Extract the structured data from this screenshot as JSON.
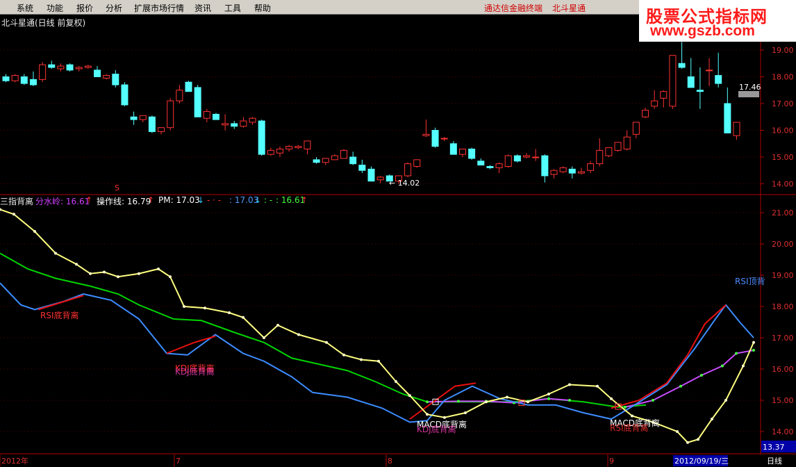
{
  "menu": {
    "items": [
      "系统",
      "功能",
      "报价",
      "分析",
      "扩展市场行情",
      "资讯",
      "工具",
      "帮助"
    ],
    "link1": "通达信金融终端",
    "link2": "北斗星通"
  },
  "watermark": {
    "line1": "股票公式指标网",
    "line2": "www.gszb.com"
  },
  "title": "北斗星通(日线 前复权)",
  "indicator": {
    "name": "三指背离",
    "l1": "分水岭: 16.61",
    "l2": "操作线: 16.79",
    "l3": "PM: 17.03",
    "l4": "- · - ",
    "l5": ": 17.03",
    "l6": ": - ",
    "l7": ": 16.61",
    "up": "↑",
    "down": "↓"
  },
  "price_axis": [
    "19.00",
    "18.00",
    "17.00",
    "16.00",
    "15.00",
    "14.00"
  ],
  "ind_axis": [
    "21.00",
    "20.00",
    "19.00",
    "18.00",
    "17.00",
    "16.00",
    "15.00",
    "14.00"
  ],
  "price_labels": {
    "high": "17.46",
    "low": "14.02"
  },
  "current_value": "13.37",
  "period": "日线",
  "dates": {
    "d0": "2012年",
    "d1": "7",
    "d2": "8",
    "d3": "9",
    "cursor": "2012/09/19/三"
  },
  "signals": {
    "s": "S",
    "rsi_bottom": "RSI底背离",
    "kdj_bottom": "KDJ底背离",
    "kdj_bottom_b": "KDJ底背离",
    "macd1": "MACD底背离",
    "kdj2": "KDJ底背离",
    "macd2": "MACD底背离",
    "rsi2": "RSI底背离",
    "rsi_top": "RSI顶背"
  },
  "colors": {
    "up": "#ff3232",
    "down": "#54ffff",
    "green": "#00d400",
    "yellow": "#ffff80",
    "blue": "#3c8cff",
    "red": "#e81010",
    "purple": "#c84cff"
  },
  "chart_data": {
    "type": "candlestick",
    "candles": [
      [
        18.0,
        18.1,
        17.8,
        17.85
      ],
      [
        17.85,
        18.1,
        17.8,
        18.05
      ],
      [
        18.0,
        18.1,
        17.7,
        17.75
      ],
      [
        17.9,
        18.2,
        17.65,
        17.7
      ],
      [
        17.9,
        18.55,
        17.8,
        18.45
      ],
      [
        18.45,
        18.6,
        18.3,
        18.35
      ],
      [
        18.3,
        18.5,
        18.2,
        18.4
      ],
      [
        18.45,
        18.5,
        18.2,
        18.25
      ],
      [
        18.3,
        18.4,
        18.2,
        18.35
      ],
      [
        18.35,
        18.45,
        18.3,
        18.4
      ],
      [
        18.25,
        18.4,
        18.0,
        18.0
      ],
      [
        17.95,
        18.1,
        17.9,
        18.05
      ],
      [
        18.1,
        18.25,
        17.6,
        17.7
      ],
      [
        17.7,
        17.8,
        16.9,
        16.95
      ],
      [
        16.5,
        16.7,
        16.2,
        16.4
      ],
      [
        16.4,
        16.55,
        16.3,
        16.55
      ],
      [
        16.5,
        16.55,
        15.9,
        15.95
      ],
      [
        15.95,
        16.1,
        15.85,
        16.1
      ],
      [
        16.1,
        17.2,
        16.0,
        17.1
      ],
      [
        17.1,
        17.7,
        17.0,
        17.5
      ],
      [
        17.8,
        17.85,
        17.45,
        17.45
      ],
      [
        17.6,
        17.7,
        16.5,
        16.5
      ],
      [
        16.45,
        16.8,
        16.3,
        16.7
      ],
      [
        16.6,
        16.65,
        16.4,
        16.4
      ],
      [
        16.2,
        16.6,
        16.0,
        16.25
      ],
      [
        16.25,
        16.35,
        16.05,
        16.15
      ],
      [
        16.15,
        16.5,
        16.1,
        16.35
      ],
      [
        16.3,
        16.5,
        16.2,
        16.45
      ],
      [
        16.35,
        16.4,
        15.05,
        15.1
      ],
      [
        15.1,
        15.35,
        15.05,
        15.25
      ],
      [
        15.15,
        15.4,
        15.0,
        15.3
      ],
      [
        15.3,
        15.45,
        15.2,
        15.4
      ],
      [
        15.35,
        15.45,
        15.3,
        15.4
      ],
      [
        15.3,
        15.6,
        15.1,
        15.6
      ],
      [
        14.9,
        15.0,
        14.75,
        14.8
      ],
      [
        14.8,
        14.95,
        14.7,
        14.95
      ],
      [
        14.9,
        15.1,
        14.9,
        15.05
      ],
      [
        14.95,
        15.3,
        14.95,
        15.25
      ],
      [
        15.0,
        15.2,
        14.7,
        14.75
      ],
      [
        14.7,
        14.9,
        14.4,
        14.5
      ],
      [
        14.55,
        14.65,
        14.1,
        14.1
      ],
      [
        14.15,
        14.3,
        14.02,
        14.25
      ],
      [
        14.3,
        14.35,
        14.1,
        14.1
      ],
      [
        14.1,
        14.3,
        14.0,
        14.3
      ],
      [
        14.3,
        14.8,
        14.25,
        14.75
      ],
      [
        14.65,
        14.9,
        14.6,
        14.9
      ],
      [
        15.8,
        16.4,
        15.75,
        15.85
      ],
      [
        16.0,
        16.1,
        15.35,
        15.4
      ],
      [
        15.7,
        15.75,
        15.6,
        15.7
      ],
      [
        15.5,
        15.6,
        15.1,
        15.1
      ],
      [
        15.1,
        15.3,
        15.0,
        15.3
      ],
      [
        15.3,
        15.35,
        14.9,
        14.95
      ],
      [
        14.85,
        14.95,
        14.7,
        14.7
      ],
      [
        14.65,
        14.7,
        14.55,
        14.6
      ],
      [
        14.6,
        14.8,
        14.4,
        14.75
      ],
      [
        14.65,
        15.1,
        14.6,
        15.05
      ],
      [
        15.05,
        15.1,
        14.8,
        14.85
      ],
      [
        15.0,
        15.15,
        14.95,
        15.05
      ],
      [
        15.0,
        15.3,
        14.85,
        15.0
      ],
      [
        15.05,
        15.1,
        14.05,
        14.3
      ],
      [
        14.35,
        14.55,
        14.2,
        14.5
      ],
      [
        14.45,
        14.65,
        14.4,
        14.6
      ],
      [
        14.55,
        14.65,
        14.2,
        14.4
      ],
      [
        14.4,
        14.6,
        14.35,
        14.45
      ],
      [
        14.5,
        14.85,
        14.4,
        14.75
      ],
      [
        14.75,
        15.7,
        14.65,
        15.25
      ],
      [
        15.05,
        15.35,
        15.0,
        15.35
      ],
      [
        15.25,
        15.5,
        15.2,
        15.55
      ],
      [
        15.3,
        16.0,
        15.25,
        15.75
      ],
      [
        15.85,
        16.3,
        15.7,
        16.3
      ],
      [
        16.5,
        16.85,
        16.45,
        16.75
      ],
      [
        16.9,
        17.5,
        16.8,
        17.1
      ],
      [
        17.2,
        17.5,
        16.85,
        17.45
      ],
      [
        16.9,
        18.4,
        16.8,
        18.8
      ],
      [
        18.5,
        19.3,
        18.3,
        18.35
      ],
      [
        18.0,
        18.7,
        17.7,
        17.6
      ],
      [
        17.5,
        18.35,
        16.8,
        17.45
      ],
      [
        18.25,
        18.7,
        17.65,
        18.25
      ],
      [
        18.05,
        18.9,
        17.6,
        17.75
      ],
      [
        17.0,
        17.6,
        15.9,
        15.9
      ],
      [
        15.8,
        16.2,
        15.65,
        16.3
      ]
    ]
  }
}
